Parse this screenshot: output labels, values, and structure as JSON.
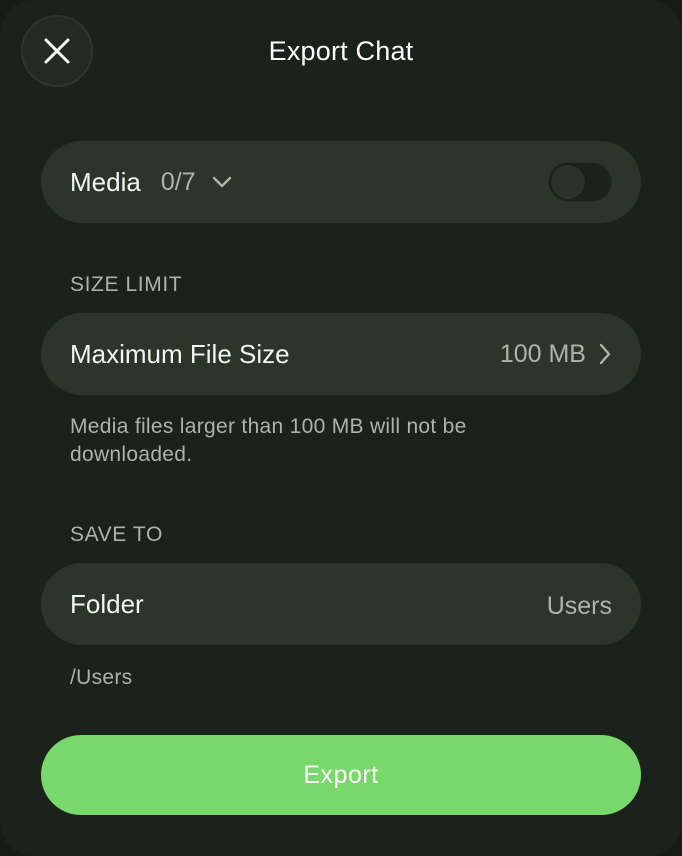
{
  "header": {
    "title": "Export Chat",
    "close_icon": "close-icon"
  },
  "media": {
    "label": "Media",
    "count": "0/7",
    "toggle_on": false
  },
  "size_limit": {
    "section_label": "SIZE LIMIT",
    "row_label": "Maximum File Size",
    "value": "100 MB",
    "note": "Media files larger than 100 MB will not be downloaded."
  },
  "save_to": {
    "section_label": "SAVE TO",
    "row_label": "Folder",
    "value": "Users",
    "path": "/Users"
  },
  "actions": {
    "export_label": "Export"
  },
  "colors": {
    "background": "#1b211b",
    "row": "#2b352a",
    "accent": "#79d86b",
    "secondary_text": "#a9b5ad"
  }
}
